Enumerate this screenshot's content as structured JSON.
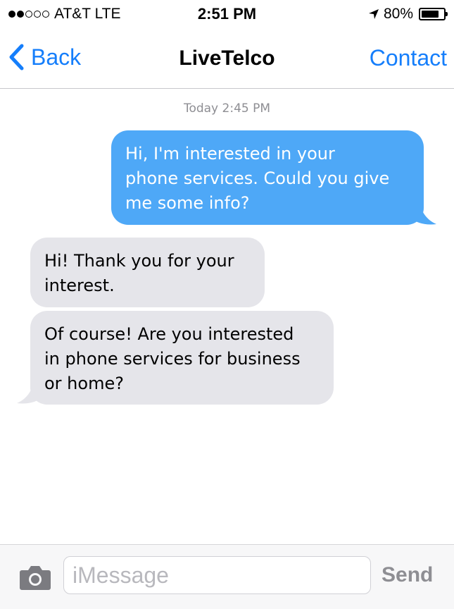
{
  "status_bar": {
    "signal_filled": 2,
    "signal_total": 5,
    "carrier": "AT&T LTE",
    "time": "2:51 PM",
    "location_icon": "location-arrow-icon",
    "battery_percent": "80%",
    "battery_level": 0.8
  },
  "nav": {
    "back_label": "Back",
    "title": "LiveTelco",
    "contact_label": "Contact"
  },
  "conversation": {
    "timestamp": "Today 2:45 PM",
    "messages": [
      {
        "direction": "sent",
        "lines": [
          "Hi, I'm interested in your",
          "phone services. Could you give",
          "me some info?"
        ]
      },
      {
        "direction": "received",
        "lines": [
          "Hi! Thank you for your",
          "interest."
        ]
      },
      {
        "direction": "received",
        "lines": [
          "Of course! Are you interested",
          "in phone services for business",
          "or home?"
        ]
      }
    ]
  },
  "input_bar": {
    "camera_icon": "camera-icon",
    "placeholder": "iMessage",
    "value": "",
    "send_label": "Send"
  },
  "colors": {
    "accent": "#157efb",
    "sent_bubble": "#4ea8f7",
    "received_bubble": "#e5e5ea"
  }
}
